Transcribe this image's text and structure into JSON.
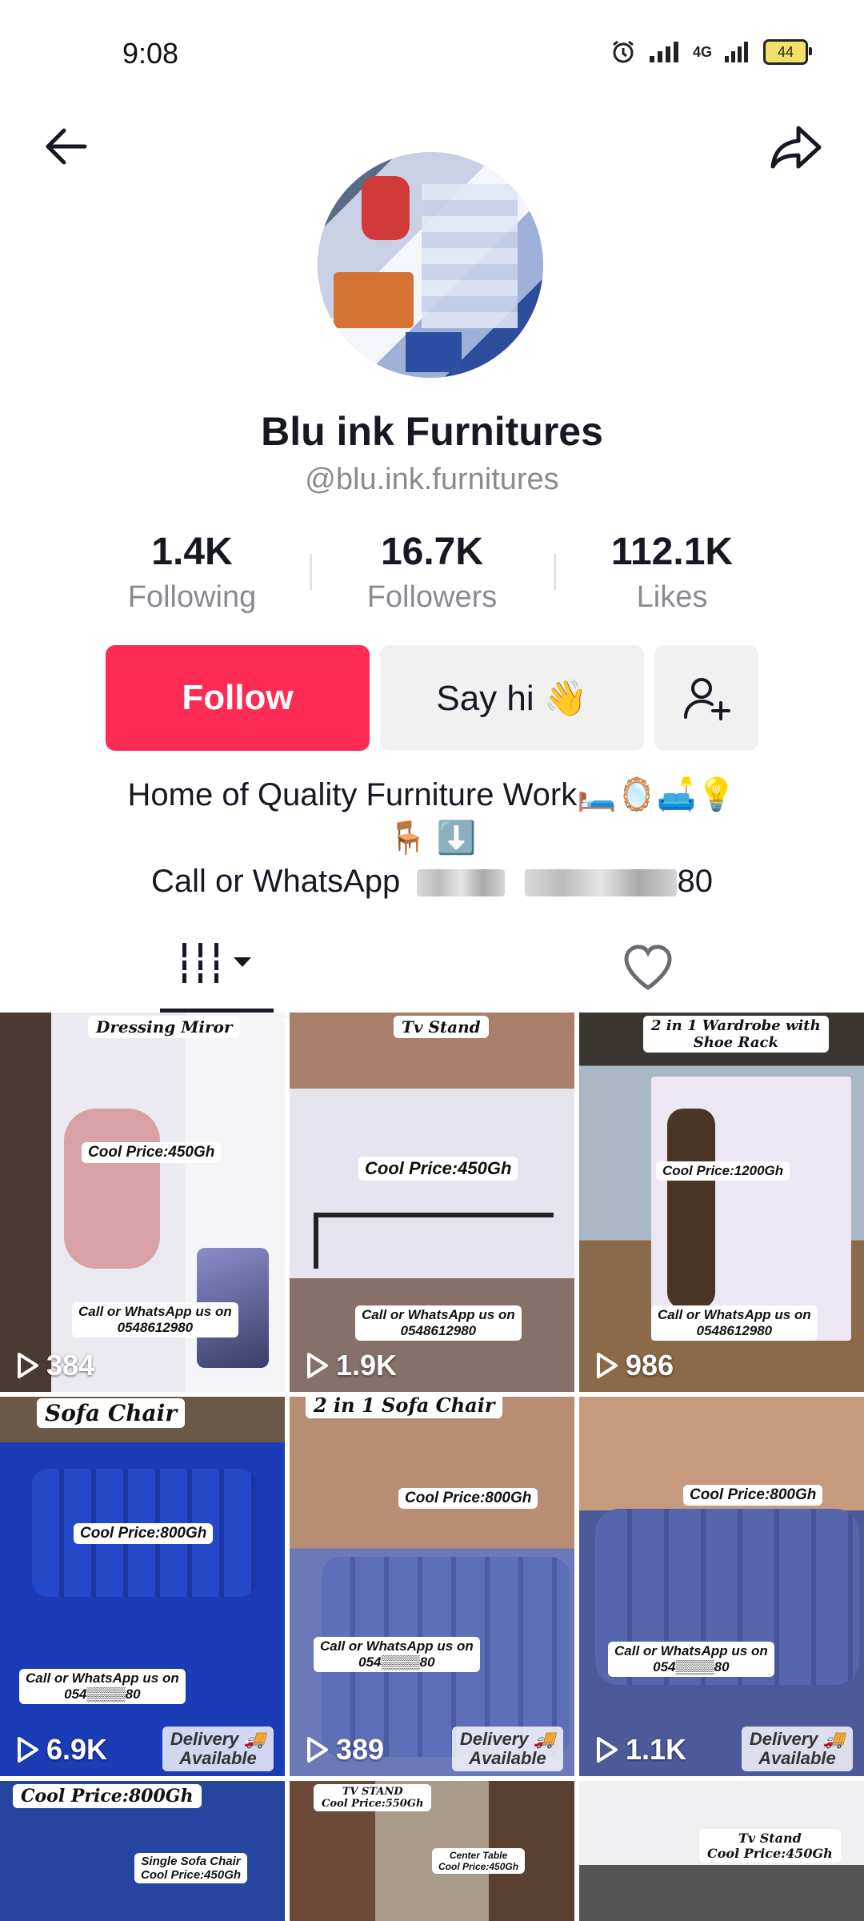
{
  "status_bar": {
    "time": "9:08",
    "network": "4G",
    "battery": "44"
  },
  "icons": {
    "back": "arrow-left-icon",
    "share": "share-icon",
    "add_friend": "person-add-icon",
    "grid": "grid-icon",
    "liked": "heart-icon",
    "play": "play-icon"
  },
  "profile": {
    "display_name": "Blu ink Furnitures",
    "username": "@blu.ink.furnitures",
    "stats": [
      {
        "value": "1.4K",
        "label": "Following"
      },
      {
        "value": "16.7K",
        "label": "Followers"
      },
      {
        "value": "112.1K",
        "label": "Likes"
      }
    ],
    "buttons": {
      "follow": "Follow",
      "say_hi": "Say hi 👋"
    },
    "bio": {
      "line1": "Home of Quality Furniture Work🛏️🪞🛋️💡",
      "line2": "🪑 ⬇️",
      "line3_prefix": "Call or WhatsApp",
      "line3_suffix": "80"
    }
  },
  "videos": [
    {
      "title": "Dressing Miror",
      "price": "Cool Price:450Gh",
      "contact": "Call or WhatsApp us on\n0548612980",
      "views": "384"
    },
    {
      "title": "Tv Stand",
      "price": "Cool Price:450Gh",
      "contact": "Call or WhatsApp us on\n0548612980",
      "views": "1.9K"
    },
    {
      "title": "2 in 1 Wardrobe with\nShoe Rack",
      "price": "Cool Price:1200Gh",
      "contact": "Call or WhatsApp us on\n0548612980",
      "views": "986"
    },
    {
      "title": "Sofa Chair",
      "price": "Cool Price:800Gh",
      "contact": "Call or WhatsApp us on\n054▒▒▒▒80",
      "views": "6.9K",
      "badge": "Delivery 🚚\nAvailable"
    },
    {
      "title": "2 in 1 Sofa Chair",
      "price": "Cool Price:800Gh",
      "contact": "Call or WhatsApp us on\n054▒▒▒▒80",
      "views": "389",
      "badge": "Delivery 🚚\nAvailable"
    },
    {
      "title": "",
      "price": "Cool Price:800Gh",
      "contact": "Call or WhatsApp us on\n054▒▒▒▒80",
      "views": "1.1K",
      "badge": "Delivery 🚚\nAvailable"
    },
    {
      "title": "Cool Price:800Gh",
      "price": "Single Sofa Chair\nCool Price:450Gh"
    },
    {
      "title": "TV STAND\nCool Price:550Gh",
      "price": "Center Table\nCool Price:450Gh"
    },
    {
      "title": "Tv Stand\nCool Price:450Gh"
    }
  ]
}
